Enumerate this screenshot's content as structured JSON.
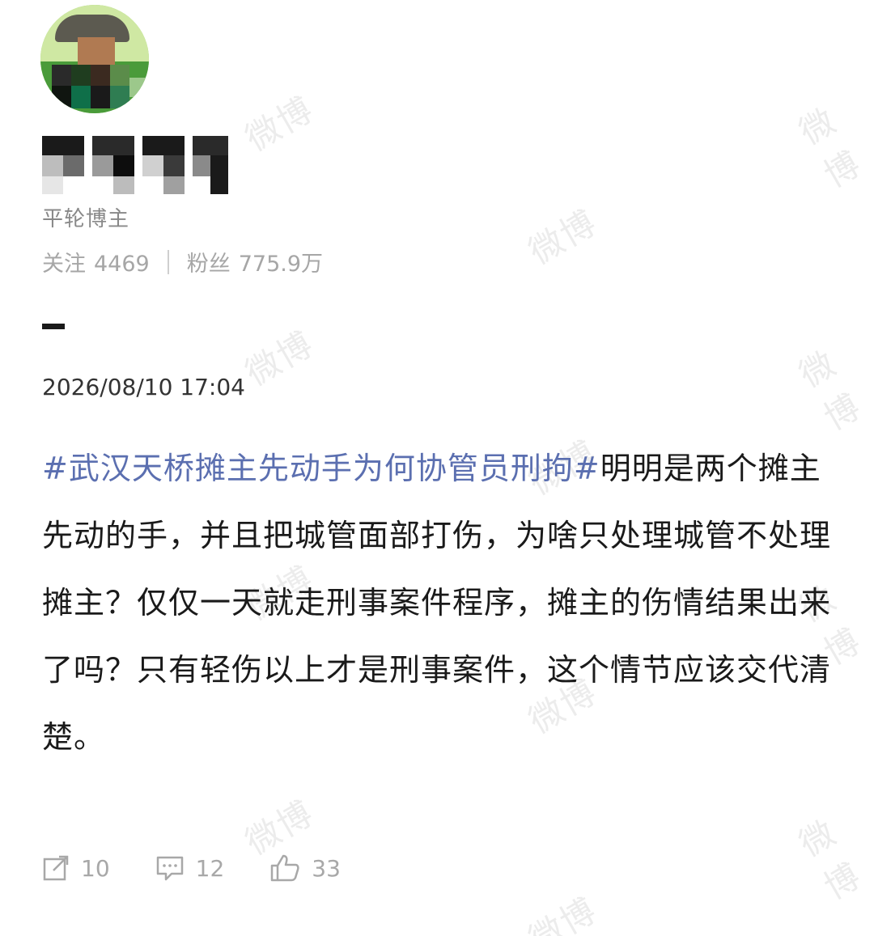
{
  "profile": {
    "name": "崇庆链事",
    "sub_label": "平轮博主",
    "following_label": "关注",
    "following_count": "4469",
    "followers_label": "粉丝",
    "followers_count": "775.9万"
  },
  "post": {
    "timestamp": "2026/08/10 17:04",
    "hashtag": "#武汉天桥摊主先动手为何协管员刑拘#",
    "body": "明明是两个摊主先动的手，并且把城管面部打伤，为啥只处理城管不处理摊主？仅仅一天就走刑事案件程序，摊主的伤情结果出来了吗？只有轻伤以上才是刑事案件，这个情节应该交代清楚。"
  },
  "actions": {
    "repost_count": "10",
    "comment_count": "12",
    "like_count": "33"
  },
  "watermark": "微博",
  "colors": {
    "hashtag": "#5b6fb0",
    "meta_gray": "#a6a6a6"
  }
}
